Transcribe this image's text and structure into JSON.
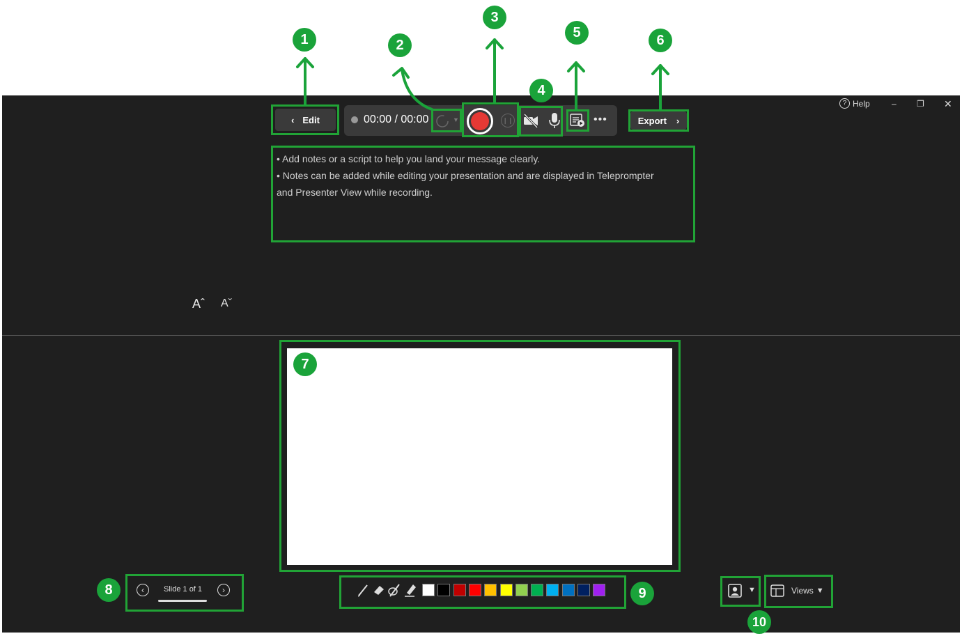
{
  "toolbar": {
    "edit_label": "Edit",
    "timer": "00:00 / 00:00",
    "export_label": "Export"
  },
  "window": {
    "help_label": "Help"
  },
  "notes": {
    "line1": "• Add notes or a script to help you land your message clearly.",
    "line2": "• Notes can be added while editing your presentation and are displayed in Teleprompter",
    "line3": "and Presenter View while recording."
  },
  "font_controls": {
    "increase": "Aˆ",
    "decrease": "Aˇ"
  },
  "slide_nav": {
    "label": "Slide 1 of 1"
  },
  "views": {
    "label": "Views"
  },
  "pen_colors": [
    "#ffffff",
    "#000000",
    "#c00000",
    "#ff0000",
    "#ffc000",
    "#ffff00",
    "#92d050",
    "#00b050",
    "#00b0f0",
    "#0070c0",
    "#002060",
    "#a020f0"
  ],
  "badges": [
    "1",
    "2",
    "3",
    "4",
    "5",
    "6",
    "7",
    "8",
    "9",
    "10"
  ],
  "colors": {
    "accent_green": "#21a336",
    "record_red": "#e53935",
    "background": "#1f1f1f"
  }
}
